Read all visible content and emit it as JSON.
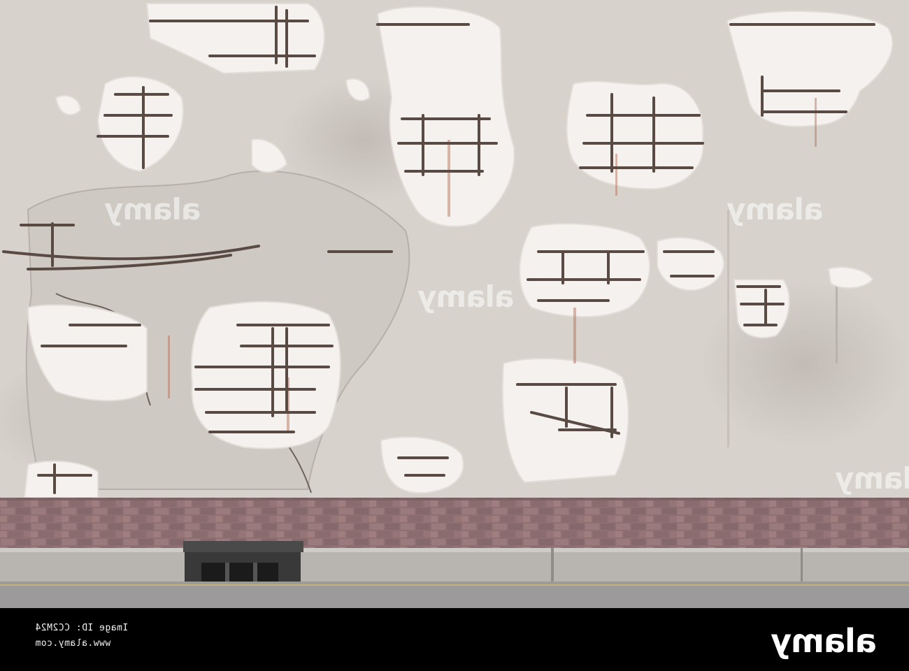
{
  "watermark": {
    "brand": "alamy",
    "image_id_label": "Image ID: CC2M24",
    "site": "www.alamy.com"
  },
  "colors": {
    "wall": "#d8d2cd",
    "spall": "#f4f1ee",
    "rebar": "#5a4a44",
    "rust": "#b06a4f",
    "brick": "#8e6f72",
    "kerb": "#b8b4b0",
    "road": "#9c9a9a"
  }
}
